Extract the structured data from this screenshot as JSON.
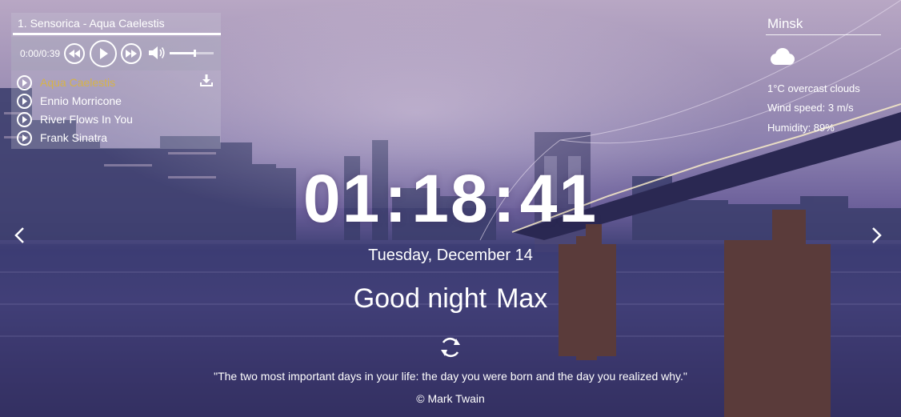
{
  "player": {
    "track_title": "1. Sensorica - Aqua Caelestis",
    "time": "0:00/0:39",
    "progress": 1.0,
    "volume": 0.55,
    "icons": [
      "prev-icon",
      "play-icon",
      "next-icon",
      "volume-icon",
      "download-icon"
    ],
    "playlist": [
      {
        "label": "Aqua Caelestis",
        "active": true
      },
      {
        "label": "Ennio Morricone",
        "active": false
      },
      {
        "label": "River Flows In You",
        "active": false
      },
      {
        "label": "Frank Sinatra",
        "active": false
      }
    ]
  },
  "weather": {
    "city": "Minsk",
    "icon": "cloud-icon",
    "temp": "1°C",
    "description": "overcast clouds",
    "wind": "Wind speed: 3 m/s",
    "humidity": "Humidity: 89%"
  },
  "clock": {
    "hours": "01",
    "minutes": "18",
    "seconds": "41",
    "separator": ":"
  },
  "date": "Tuesday, December 14",
  "greeting": {
    "text": "Good night",
    "name": "Max"
  },
  "quote": {
    "text": "\"The two most important days in your life: the day you were born and the day you realized why.\"",
    "author": "© Mark Twain"
  },
  "colors": {
    "accent": "#d6b349",
    "text": "#ffffff"
  }
}
